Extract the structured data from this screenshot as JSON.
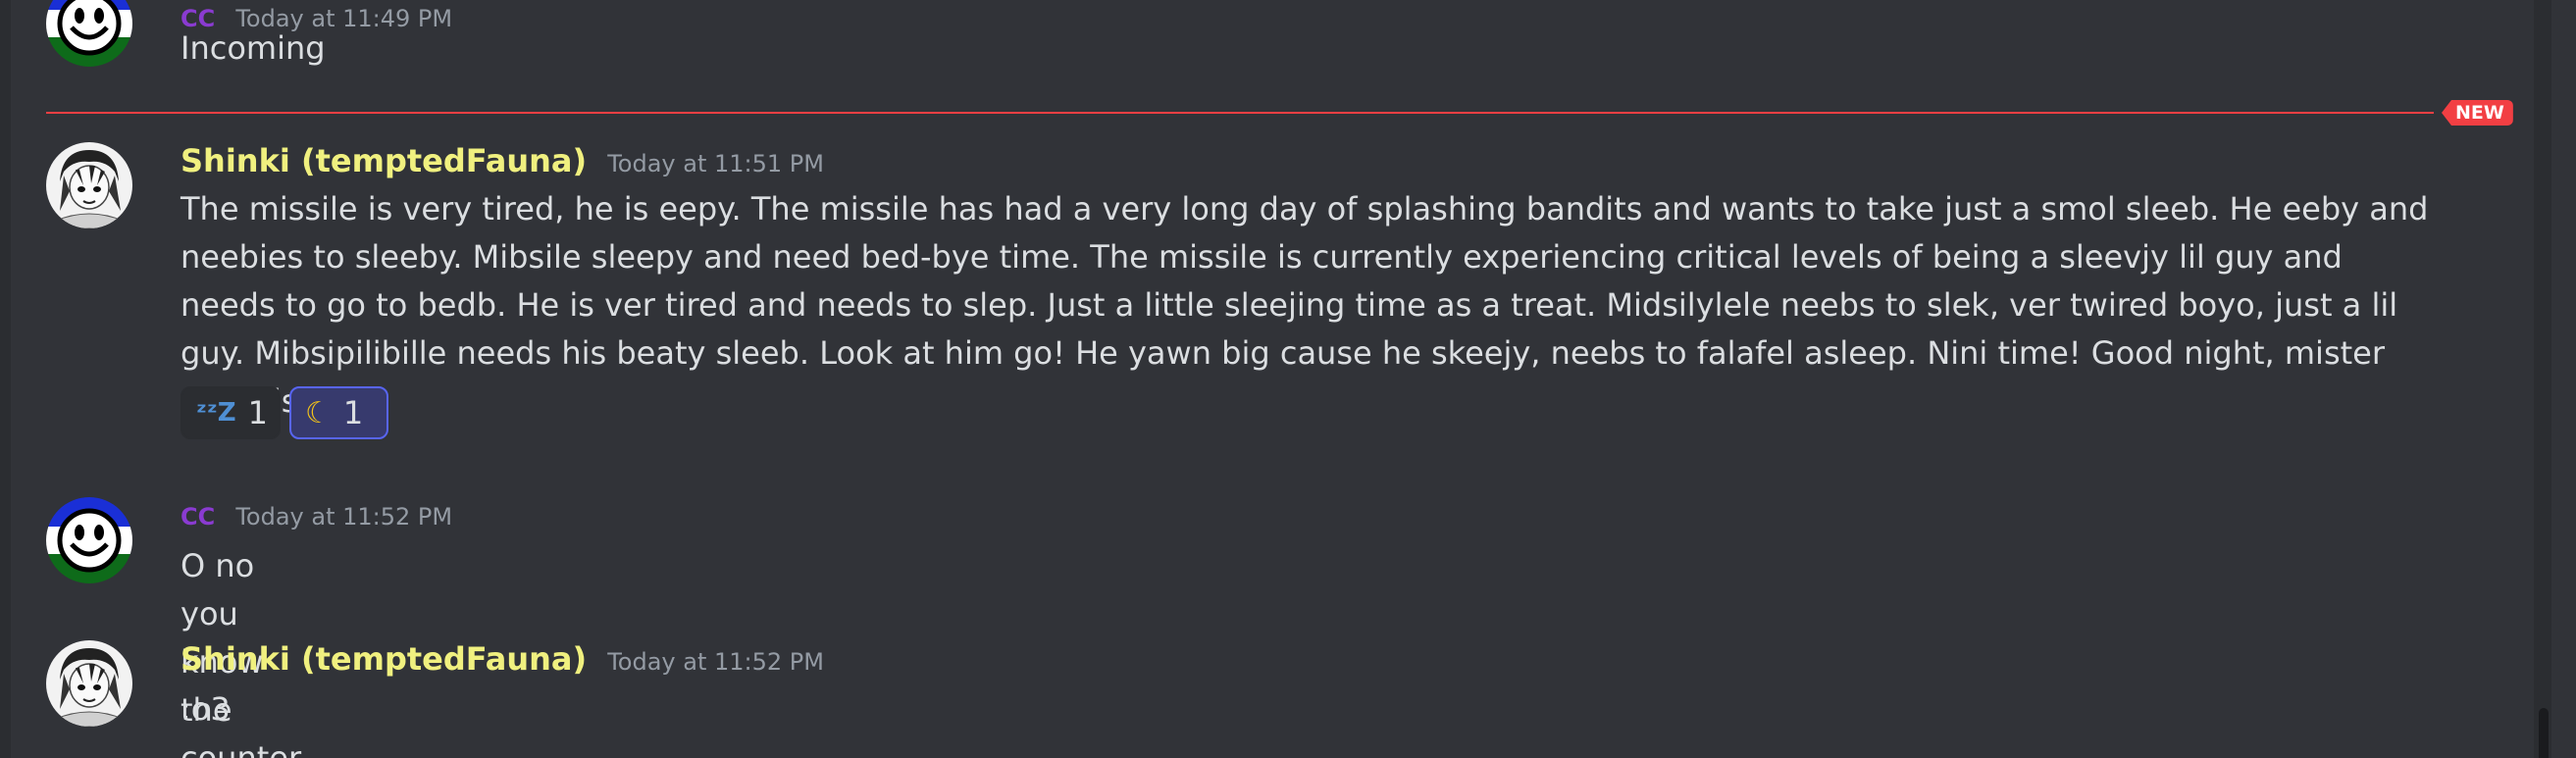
{
  "divider": {
    "new_label": "NEW"
  },
  "messages": [
    {
      "author": "CC",
      "author_color": "#8a3bd1",
      "timestamp": "Today at 11:49 PM",
      "content": "Incoming",
      "avatar_icon": "smiley-flag-avatar"
    },
    {
      "author": "Shinki (temptedFauna)",
      "author_color": "#f0f07f",
      "timestamp": "Today at 11:51 PM",
      "content": "The missile is very tired, he is eepy. The missile has had a very long day of splashing bandits and wants to take just a smol sleeb. He eeby and neebies to sleeby. Mibsile sleepy and need bed-bye time. The missile is currently experiencing critical levels of being a sleevjy lil guy and needs to go to bedb. He is ver tired and needs to slep. Just a little sleejing time as a treat. Midsilylele neebs to slek, ver twired boyo, just a lil guy. Mibsipilibille needs his beaty sleeb. Look at him go! He yawn big cause he skeejy, neebs to falafel asleep. Nini time! Good night, mister the missile.",
      "avatar_icon": "anime-sketch-avatar",
      "reactions": [
        {
          "emoji": "zzz-icon",
          "glyph": "ᶻᶻZ",
          "count": "1",
          "selected": false
        },
        {
          "emoji": "crescent-moon-icon",
          "glyph": "☾",
          "count": "1",
          "selected": true
        }
      ]
    },
    {
      "author": "CC",
      "author_color": "#8a3bd1",
      "timestamp": "Today at 11:52 PM",
      "content": "O no you know the counter",
      "avatar_icon": "smiley-flag-avatar"
    },
    {
      "author": "Shinki (temptedFauna)",
      "author_color": "#f0f07f",
      "timestamp": "Today at 11:52 PM",
      "content": ":o3",
      "avatar_icon": "anime-sketch-avatar"
    }
  ],
  "colors": {
    "background": "#313338",
    "new_divider": "#f23f43",
    "text": "#dbdee1",
    "timestamp": "#949ba4"
  }
}
